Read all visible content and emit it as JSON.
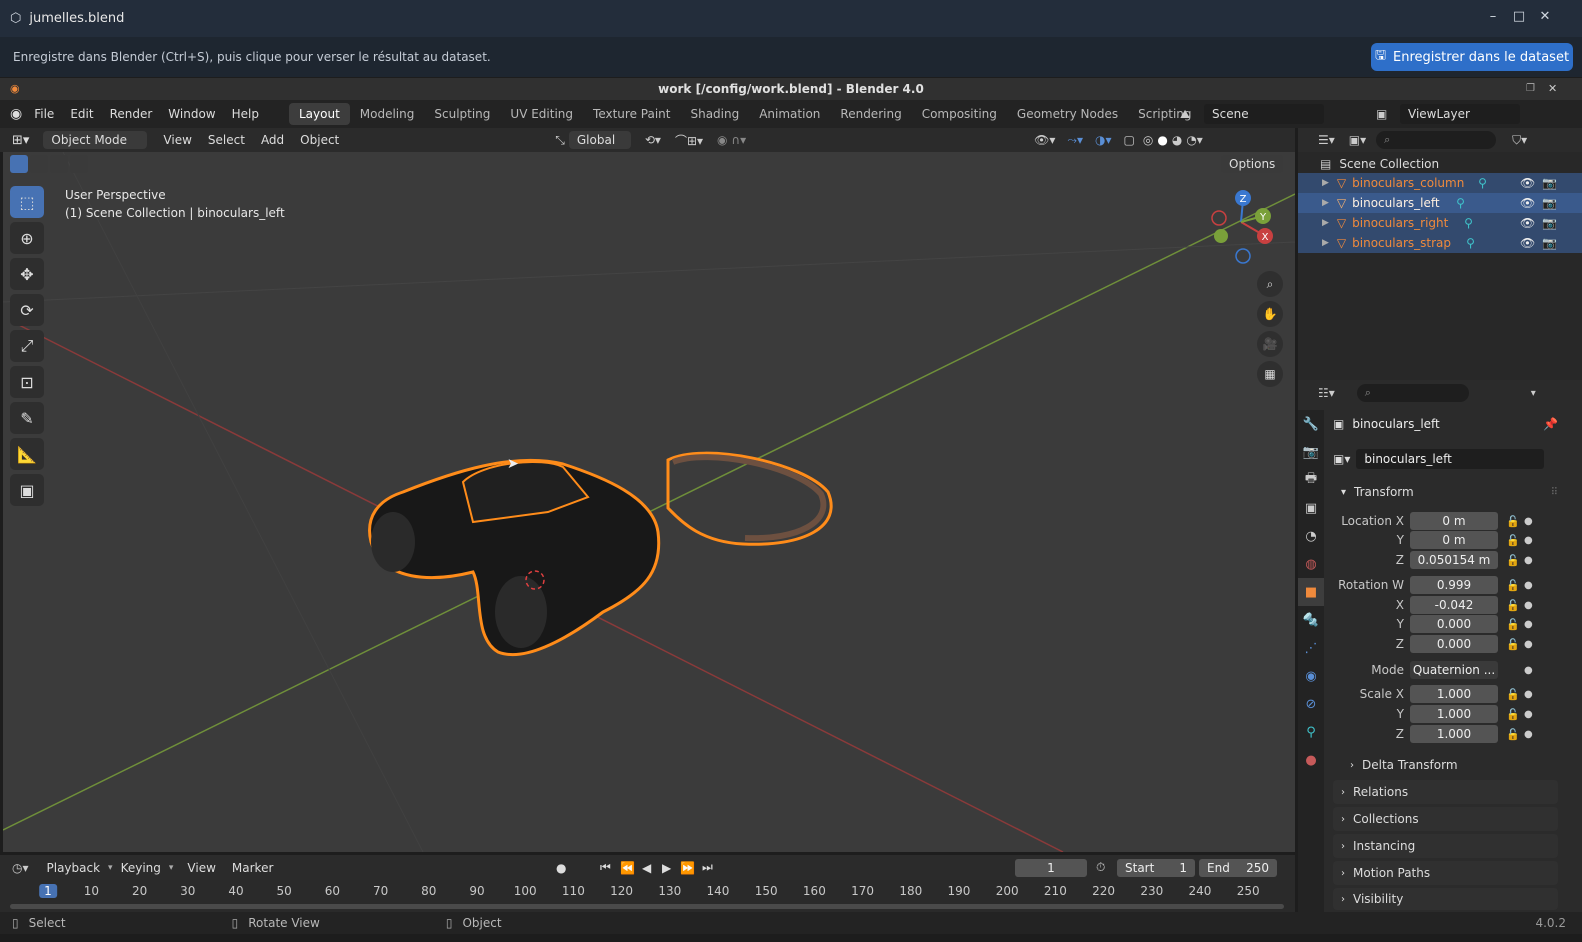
{
  "window": {
    "title": "jumelles.blend",
    "minimize": "–",
    "maximize": "□",
    "close": "✕"
  },
  "notice": {
    "message": "Enregistre dans Blender (Ctrl+S), puis clique pour verser le résultat au dataset.",
    "button": "Enregistrer dans le dataset"
  },
  "blender_title": "work [/config/work.blend] - Blender 4.0",
  "menus": [
    "File",
    "Edit",
    "Render",
    "Window",
    "Help"
  ],
  "workspaces": [
    "Layout",
    "Modeling",
    "Sculpting",
    "UV Editing",
    "Texture Paint",
    "Shading",
    "Animation",
    "Rendering",
    "Compositing",
    "Geometry Nodes",
    "Scripting"
  ],
  "active_workspace": "Layout",
  "scene": {
    "name": "Scene",
    "view_layer": "ViewLayer"
  },
  "viewport_header": {
    "mode": "Object Mode",
    "view": "View",
    "select": "Select",
    "add": "Add",
    "object": "Object",
    "transform": "Global",
    "options": "Options"
  },
  "viewport_info": {
    "line1": "User Perspective",
    "line2": "(1) Scene Collection | binoculars_left"
  },
  "outliner": {
    "root": "Scene Collection",
    "items": [
      {
        "label": "binoculars_column"
      },
      {
        "label": "binoculars_left"
      },
      {
        "label": "binoculars_right"
      },
      {
        "label": "binoculars_strap"
      }
    ]
  },
  "properties": {
    "object_name": "binoculars_left",
    "data_name": "binoculars_left",
    "transform_title": "Transform",
    "location_x_label": "Location X",
    "location_x": "0 m",
    "location_y_label": "Y",
    "location_y": "0 m",
    "location_z_label": "Z",
    "location_z": "0.050154 m",
    "rotation_w_label": "Rotation W",
    "rotation_w": "0.999",
    "rotation_x_label": "X",
    "rotation_x": "-0.042",
    "rotation_y_label": "Y",
    "rotation_y": "0.000",
    "rotation_z_label": "Z",
    "rotation_z": "0.000",
    "mode_label": "Mode",
    "mode": "Quaternion ...",
    "scale_x_label": "Scale X",
    "scale_x": "1.000",
    "scale_y_label": "Y",
    "scale_y": "1.000",
    "scale_z_label": "Z",
    "scale_z": "1.000",
    "delta": "Delta Transform",
    "panels": [
      "Relations",
      "Collections",
      "Instancing",
      "Motion Paths",
      "Visibility"
    ]
  },
  "timeline": {
    "playback": "Playback",
    "keying": "Keying",
    "view": "View",
    "marker": "Marker",
    "current_frame": "1",
    "start_label": "Start",
    "start": "1",
    "end_label": "End",
    "end": "250",
    "ticks": [
      "1",
      "10",
      "20",
      "30",
      "40",
      "50",
      "60",
      "70",
      "80",
      "90",
      "100",
      "110",
      "120",
      "130",
      "140",
      "150",
      "160",
      "170",
      "180",
      "190",
      "200",
      "210",
      "220",
      "230",
      "240",
      "250"
    ]
  },
  "statusbar": {
    "select": "Select",
    "rotate": "Rotate View",
    "object": "Object",
    "version": "4.0.2"
  },
  "colors": {
    "accent": "#4772b3",
    "selection_outline": "#ff8c1a",
    "outliner_selected_text": "#f08a3c",
    "x_axis": "#c84040",
    "y_axis": "#7aa03a",
    "z_axis": "#3a78d0"
  },
  "gizmo": {
    "x": "X",
    "y": "Y",
    "z": "Z"
  }
}
